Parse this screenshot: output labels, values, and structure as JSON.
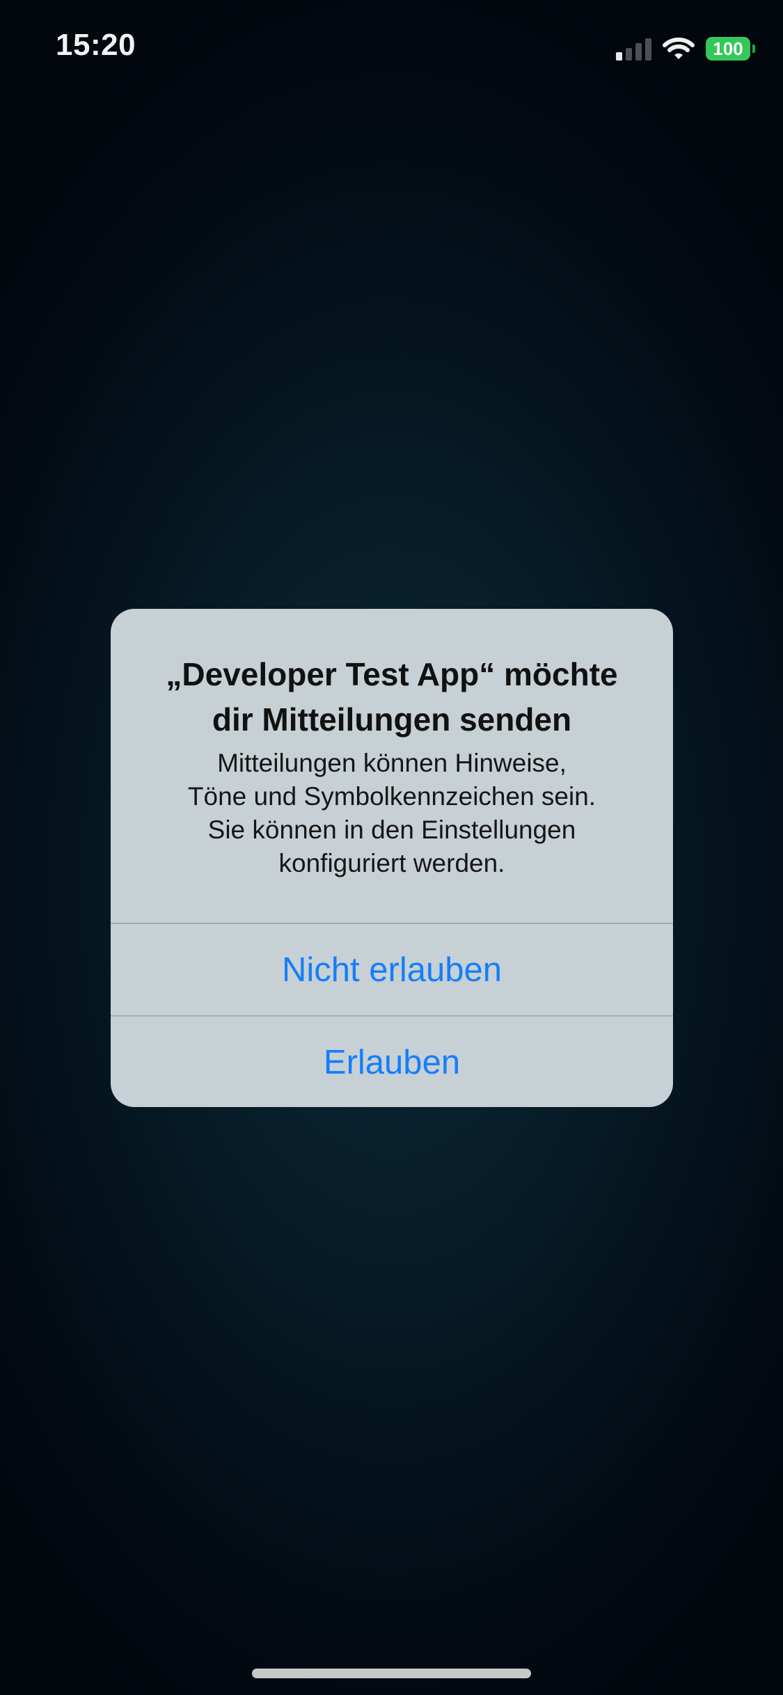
{
  "status_bar": {
    "time": "15:20",
    "battery_level": "100",
    "signal_bars_active": 1,
    "signal_bars_total": 4,
    "icons": [
      "cellular-signal-icon",
      "wifi-icon",
      "battery-icon"
    ]
  },
  "alert": {
    "title_line1": "„Developer Test App“ möchte",
    "title_line2": "dir Mitteilungen senden",
    "message_lines": [
      "Mitteilungen können Hinweise,",
      "Töne und Symbolkennzeichen sein.",
      "Sie können in den Einstellungen",
      "konfiguriert werden."
    ],
    "deny_label": "Nicht erlauben",
    "allow_label": "Erlauben"
  },
  "colors": {
    "accent": "#147efb",
    "battery": "#34c759",
    "alert_background": "#c7d0d4"
  }
}
